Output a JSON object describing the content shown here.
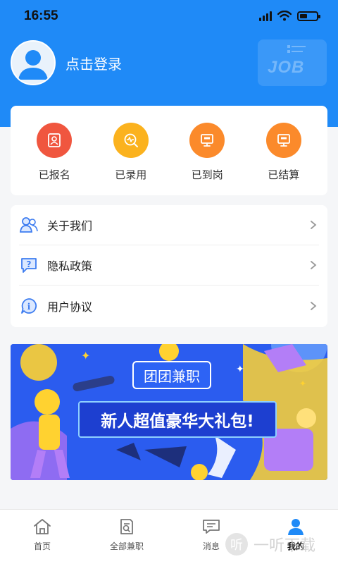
{
  "status_bar": {
    "time": "16:55"
  },
  "profile": {
    "login_text": "点击登录"
  },
  "header": {
    "badge": "JOB"
  },
  "status_items": [
    {
      "label": "已报名",
      "icon": "id-card-icon",
      "color": "#f0563f"
    },
    {
      "label": "已录用",
      "icon": "activity-search-icon",
      "color": "#fbb21e"
    },
    {
      "label": "已到岗",
      "icon": "monitor-icon",
      "color": "#fb8a2b"
    },
    {
      "label": "已结算",
      "icon": "monitor-icon",
      "color": "#fb8a2b"
    }
  ],
  "menu": [
    {
      "label": "关于我们",
      "icon": "people-icon"
    },
    {
      "label": "隐私政策",
      "icon": "question-bubble-icon"
    },
    {
      "label": "用户协议",
      "icon": "info-bubble-icon"
    }
  ],
  "banner": {
    "title": "团团兼职",
    "subtitle": "新人超值豪华大礼包!"
  },
  "tabs": [
    {
      "label": "首页",
      "icon": "home-icon",
      "active": false
    },
    {
      "label": "全部兼职",
      "icon": "document-search-icon",
      "active": false
    },
    {
      "label": "消息",
      "icon": "message-icon",
      "active": false
    },
    {
      "label": "我的",
      "icon": "person-icon",
      "active": true
    }
  ],
  "watermark": {
    "text": "一听下载"
  },
  "colors": {
    "primary": "#1f8af7",
    "background": "#f5f6f8"
  }
}
